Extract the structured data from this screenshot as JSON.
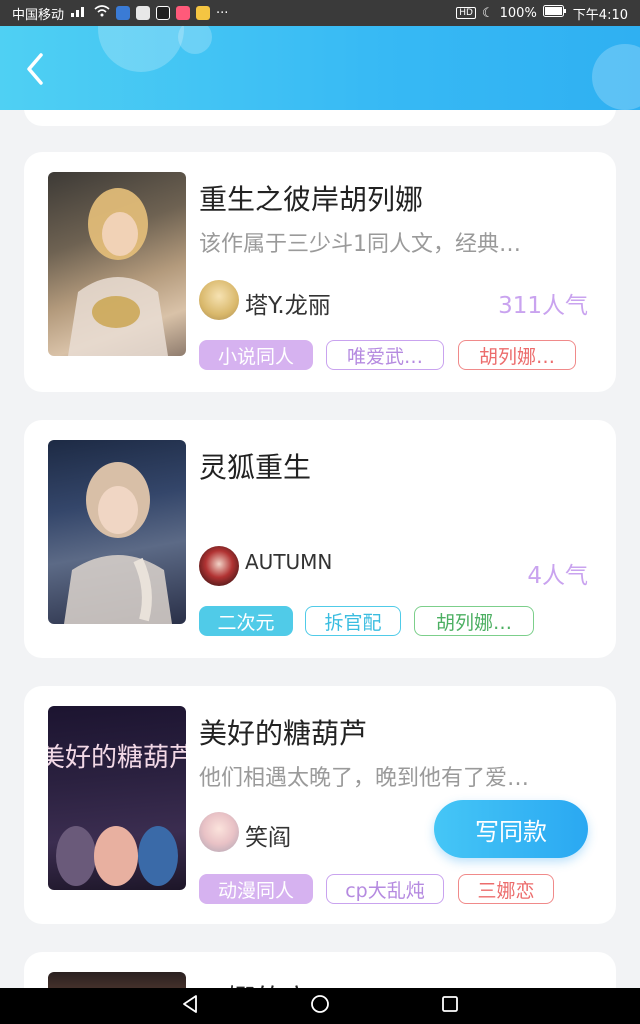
{
  "status_bar": {
    "carrier": "中国移动",
    "battery": "100%",
    "time": "下午4:10"
  },
  "cards": [
    {
      "title": "重生之彼岸胡列娜",
      "desc": "该作属于三少斗1同人文，经典…",
      "author": "塔Y.龙丽",
      "popularity": "311人气",
      "tags": [
        "小说同人",
        "唯爱武…",
        "胡列娜…"
      ]
    },
    {
      "title": "灵狐重生",
      "desc": "",
      "author": "AUTUMN",
      "popularity": "4人气",
      "tags": [
        "二次元",
        "拆官配",
        "胡列娜…"
      ]
    },
    {
      "title": "美好的糖葫芦",
      "desc": "他们相遇太晚了，晚到他有了爱…",
      "author": "笑阎",
      "popularity": "",
      "tags": [
        "动漫同人",
        "cp大乱炖",
        "三娜恋"
      ],
      "cover_text": "美好的糖葫芦"
    },
    {
      "title": "三娜的帝"
    }
  ],
  "write_button": "写同款",
  "icons": {
    "back": "chevron-left-icon",
    "nav": [
      "back-triangle-icon",
      "home-circle-icon",
      "recents-square-icon"
    ]
  }
}
